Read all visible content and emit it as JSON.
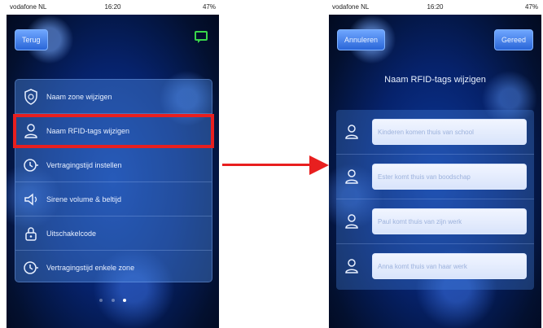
{
  "left_screen": {
    "status": {
      "carrier": "vodafone NL",
      "time": "16:20",
      "battery": "47%"
    },
    "back_button": "Terug",
    "menu_items": [
      {
        "label": "Naam zone wijzigen",
        "icon": "shield-icon"
      },
      {
        "label": "Naam RFID-tags wijzigen",
        "icon": "user-icon"
      },
      {
        "label": "Vertragingstijd instellen",
        "icon": "timer-icon"
      },
      {
        "label": "Sirene volume & beltijd",
        "icon": "speaker-icon"
      },
      {
        "label": "Uitschakelcode",
        "icon": "lock-icon"
      },
      {
        "label": "Vertragingstijd enkele zone",
        "icon": "timer-zone-icon"
      }
    ],
    "page_dots": 3,
    "active_dot": 3
  },
  "right_screen": {
    "status": {
      "carrier": "vodafone NL",
      "time": "16:20",
      "battery": "47%"
    },
    "cancel_button": "Annuleren",
    "done_button": "Gereed",
    "title": "Naam RFID-tags wijzigen",
    "fields": [
      {
        "placeholder": "Kinderen komen thuis van school"
      },
      {
        "placeholder": "Ester komt thuis van boodschap"
      },
      {
        "placeholder": "Paul komt thuis van zijn werk"
      },
      {
        "placeholder": "Anna komt thuis van haar werk"
      }
    ]
  },
  "colors": {
    "highlight": "#e81f1f",
    "chat_icon": "#39d64a",
    "background_blue": "#0d3a9e"
  }
}
